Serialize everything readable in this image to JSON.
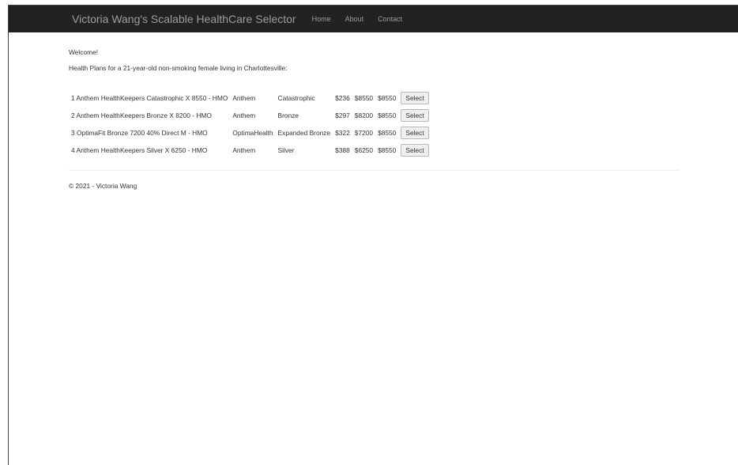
{
  "navbar": {
    "brand": "Victoria Wang's Scalable HealthCare Selector",
    "links": [
      "Home",
      "About",
      "Contact"
    ]
  },
  "main": {
    "welcome": "Welcome!",
    "subtitle": "Health Plans for a 21-year-old non-smoking female living in Charlottesville:",
    "plans": [
      {
        "rank": "1",
        "name": "Anthem HealthKeepers Catastrophic X 8550 - HMO",
        "carrier": "Anthem",
        "metal": "Catastrophic",
        "premium": "$236",
        "deductible": "$8550",
        "max_oop": "$8550",
        "action": "Select"
      },
      {
        "rank": "2",
        "name": "Anthem HealthKeepers Bronze X 8200 - HMO",
        "carrier": "Anthem",
        "metal": "Bronze",
        "premium": "$297",
        "deductible": "$8200",
        "max_oop": "$8550",
        "action": "Select"
      },
      {
        "rank": "3",
        "name": "OptimaFit Bronze 7200 40% Direct M - HMO",
        "carrier": "OptimaHealth",
        "metal": "Expanded Bronze",
        "premium": "$322",
        "deductible": "$7200",
        "max_oop": "$8550",
        "action": "Select"
      },
      {
        "rank": "4",
        "name": "Anthem HealthKeepers Silver X 6250 - HMO",
        "carrier": "Anthem",
        "metal": "Silver",
        "premium": "$388",
        "deductible": "$6250",
        "max_oop": "$8550",
        "action": "Select"
      }
    ]
  },
  "footer": {
    "text": "© 2021 - Victoria Wang"
  }
}
